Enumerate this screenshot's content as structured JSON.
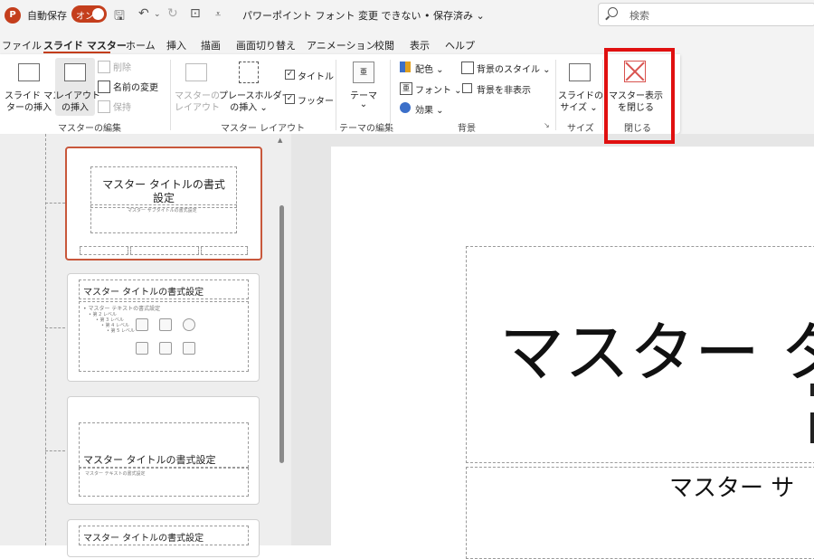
{
  "titlebar": {
    "app_icon_letter": "P",
    "autosave_label": "自動保存",
    "autosave_state": "オン",
    "doc_title": "パワーポイント フォント 変更 できない • 保存済み ⌄",
    "search_placeholder": "検索"
  },
  "tabs": [
    {
      "label": "ファイル"
    },
    {
      "label": "スライド マスター",
      "active": true
    },
    {
      "label": "ホーム"
    },
    {
      "label": "挿入"
    },
    {
      "label": "描画"
    },
    {
      "label": "画面切り替え"
    },
    {
      "label": "アニメーション"
    },
    {
      "label": "校閲"
    },
    {
      "label": "表示"
    },
    {
      "label": "ヘルプ"
    }
  ],
  "ribbon": {
    "master_edit": {
      "insert_master_l1": "スライド マス",
      "insert_master_l2": "ターの挿入",
      "insert_layout_l1": "レイアウト",
      "insert_layout_l2": "の挿入",
      "delete": "削除",
      "rename": "名前の変更",
      "preserve": "保持",
      "group": "マスターの編集"
    },
    "master_layout": {
      "master_layout_l1": "マスターの",
      "master_layout_l2": "レイアウト",
      "placeholder_l1": "プレースホルダー",
      "placeholder_l2": "の挿入 ⌄",
      "title_check": "タイトル",
      "footer_check": "フッター",
      "group": "マスター レイアウト"
    },
    "theme_edit": {
      "theme": "テーマ",
      "theme_caret": "⌄",
      "group": "テーマの編集"
    },
    "background": {
      "colors": "配色 ⌄",
      "fonts": "フォント ⌄",
      "effects": "効果 ⌄",
      "bg_styles": "背景のスタイル ⌄",
      "hide_bg": "背景を非表示",
      "group": "背景",
      "launcher": "↘"
    },
    "size": {
      "slide_size_l1": "スライドの",
      "slide_size_l2": "サイズ ⌄",
      "group": "サイズ"
    },
    "close": {
      "close_l1": "マスター表示",
      "close_l2": "を閉じる",
      "group": "閉じる"
    }
  },
  "thumbnails": {
    "t1_title_l1": "マスター タイトルの書式",
    "t1_title_l2": "設定",
    "t1_sub": "マスター サブタイトルの書式設定",
    "t2_title": "マスター タイトルの書式設定",
    "t2_body": "• マスター テキストの書式設定",
    "t2_l2": "• 第 2 レベル",
    "t2_l3": "• 第 3 レベル",
    "t2_l4": "• 第 4 レベル",
    "t2_l5": "• 第 5 レベル",
    "t3_title": "マスター タイトルの書式設定",
    "t3_sub": "マスター テキストの書式設定",
    "t4_title": "マスター タイトルの書式設定"
  },
  "slide": {
    "title_partial": "マスター タ",
    "subtitle_partial": "マスター サ"
  },
  "colors": {
    "accent": "#c43e1c",
    "highlight_box": "#e01010"
  },
  "icons": [
    "powerpoint-logo",
    "save-icon",
    "undo-icon",
    "redo-icon",
    "present-icon",
    "customize-icon",
    "search-icon",
    "close-master-icon"
  ]
}
